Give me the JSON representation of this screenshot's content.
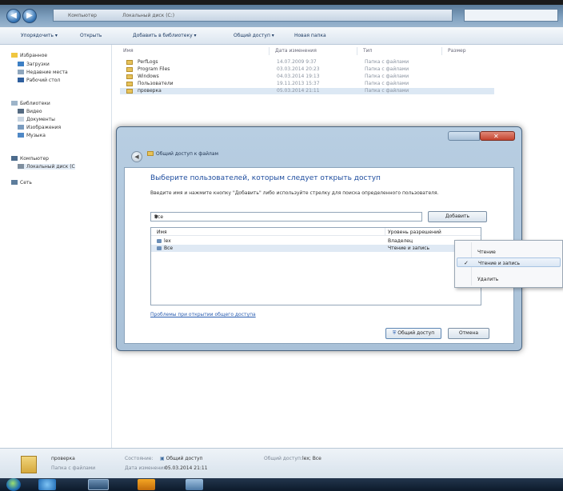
{
  "window": {
    "address_segments": [
      "Компьютер",
      "Локальный диск (C:)"
    ]
  },
  "toolbar": {
    "organize": "Упорядочить ▾",
    "open": "Открыть",
    "add_to_library": "Добавить в библиотеку ▾",
    "share": "Общий доступ ▾",
    "new_folder": "Новая папка"
  },
  "nav": {
    "favorites": "Избранное",
    "downloads": "Загрузки",
    "recent": "Недавние места",
    "desktop": "Рабочий стол",
    "libraries": "Библиотеки",
    "videos": "Видео",
    "documents": "Документы",
    "pictures": "Изображения",
    "music": "Музыка",
    "computer": "Компьютер",
    "local_disk": "Локальный диск (C",
    "network": "Сеть"
  },
  "file_list": {
    "columns": [
      "Имя",
      "Дата изменения",
      "Тип",
      "Размер"
    ],
    "rows": [
      {
        "name": "PerfLogs",
        "date": "14.07.2009 9:37",
        "type": "Папка с файлами"
      },
      {
        "name": "Program Files",
        "date": "03.03.2014 20:23",
        "type": "Папка с файлами"
      },
      {
        "name": "Windows",
        "date": "04.03.2014 19:13",
        "type": "Папка с файлами"
      },
      {
        "name": "Пользователи",
        "date": "19.11.2013 15:37",
        "type": "Папка с файлами"
      },
      {
        "name": "проверка",
        "date": "05.03.2014 21:11",
        "type": "Папка с файлами"
      }
    ]
  },
  "dialog": {
    "title": "Общий доступ к файлам",
    "heading": "Выберите пользователей, которым следует открыть доступ",
    "instruction": "Введите имя и нажмите кнопку \"Добавить\" либо используйте стрелку для поиска определенного пользователя.",
    "combo_value": "Все",
    "add_button": "Добавить",
    "table_headers": {
      "name": "Имя",
      "level": "Уровень разрешений"
    },
    "users": [
      {
        "name": "lex",
        "level": "Владелец"
      },
      {
        "name": "Все",
        "level": "Чтение и запись"
      }
    ],
    "help_link": "Проблемы при открытии общего доступа",
    "share_button": "Общий доступ",
    "cancel_button": "Отмена"
  },
  "context_menu": {
    "items": [
      {
        "label": "Чтение",
        "checked": false
      },
      {
        "label": "Чтение и запись",
        "checked": true
      },
      {
        "label": "Удалить",
        "checked": false
      }
    ]
  },
  "details": {
    "name": "проверка",
    "type": "Папка с файлами",
    "state_label": "Состояние:",
    "state_value": "Общий доступ",
    "date_label": "Дата изменения:",
    "date_value": "05.03.2014 21:11",
    "shared_with_label": "Общий доступ:",
    "shared_with_value": "lex; Все"
  },
  "colors": {
    "accent": "#1d4c9e",
    "selection": "#dce8f4",
    "close_button": "#c5432e"
  }
}
